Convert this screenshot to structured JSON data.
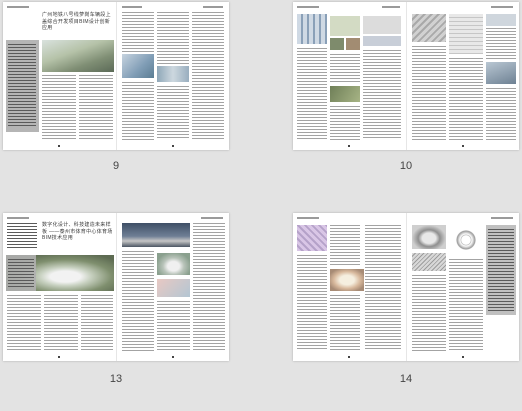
{
  "spreads": [
    {
      "number_label": "9",
      "title": "广州地铁八号线萝岗车辆段上盖综合开发项目BIM设计创新应用"
    },
    {
      "number_label": "10",
      "title": ""
    },
    {
      "number_label": "13",
      "title": "数字化设计、科技建造未来样板 ——泰州市体育中心体育场 BIM技术应用"
    },
    {
      "number_label": "14",
      "title": ""
    }
  ]
}
